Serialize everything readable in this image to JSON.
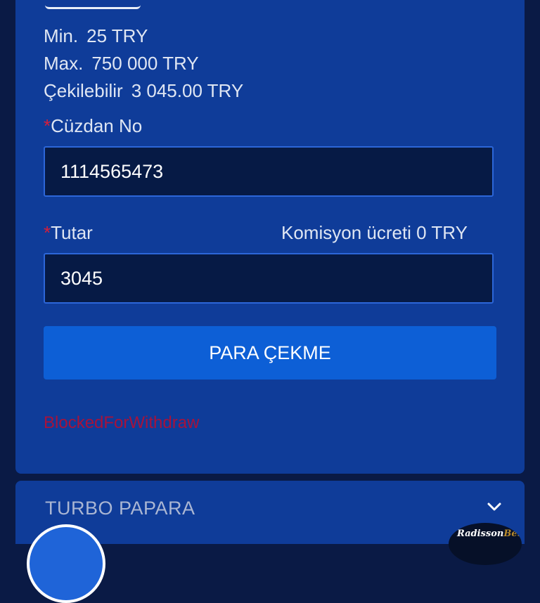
{
  "limits": {
    "min_label": "Min.",
    "min_value": "25 TRY",
    "max_label": "Max.",
    "max_value": "750 000 TRY",
    "available_label": "Çekilebilir",
    "available_value": "3 045.00 TRY"
  },
  "wallet": {
    "required_mark": "*",
    "label": "Cüzdan No",
    "value": "1114565473"
  },
  "amount": {
    "required_mark": "*",
    "label": "Tutar",
    "commission": "Komisyon ücreti 0 TRY",
    "value": "3045"
  },
  "withdraw_button": "PARA ÇEKME",
  "error_text": "BlockedForWithdraw",
  "accordion": {
    "title": "TURBO PAPARA",
    "icon": "chevron-down-icon"
  },
  "logo": {
    "text_main": "Radisson",
    "text_accent": "Bet"
  },
  "colors": {
    "background": "#0a1a45",
    "panel": "#0f3c99",
    "button": "#0d5fd6",
    "error": "#a7123b",
    "required": "#d81e3a"
  }
}
